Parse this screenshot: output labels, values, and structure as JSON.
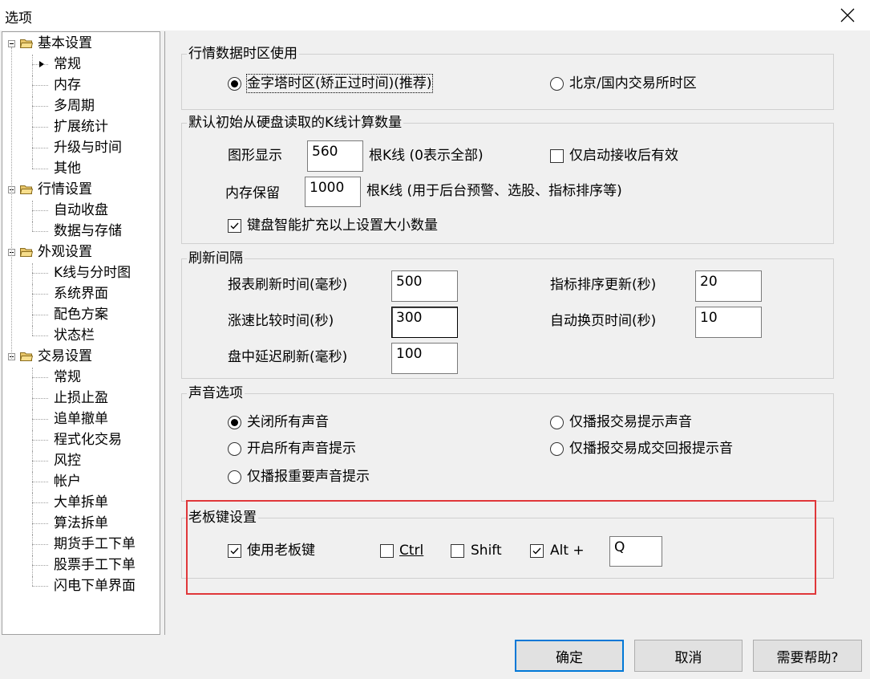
{
  "window": {
    "title": "选项"
  },
  "tree": {
    "nodes": [
      {
        "label": "基本设置",
        "level": 0
      },
      {
        "label": "常规",
        "level": 1,
        "selected": true
      },
      {
        "label": "内存",
        "level": 1
      },
      {
        "label": "多周期",
        "level": 1
      },
      {
        "label": "扩展统计",
        "level": 1
      },
      {
        "label": "升级与时间",
        "level": 1
      },
      {
        "label": "其他",
        "level": 1
      },
      {
        "label": "行情设置",
        "level": 0
      },
      {
        "label": "自动收盘",
        "level": 1
      },
      {
        "label": "数据与存储",
        "level": 1
      },
      {
        "label": "外观设置",
        "level": 0
      },
      {
        "label": "K线与分时图",
        "level": 1
      },
      {
        "label": "系统界面",
        "level": 1
      },
      {
        "label": "配色方案",
        "level": 1
      },
      {
        "label": "状态栏",
        "level": 1
      },
      {
        "label": "交易设置",
        "level": 0
      },
      {
        "label": "常规",
        "level": 1
      },
      {
        "label": "止损止盈",
        "level": 1
      },
      {
        "label": "追单撤单",
        "level": 1
      },
      {
        "label": "程式化交易",
        "level": 1
      },
      {
        "label": "风控",
        "level": 1
      },
      {
        "label": "帐户",
        "level": 1
      },
      {
        "label": "大单拆单",
        "level": 1
      },
      {
        "label": "算法拆单",
        "level": 1
      },
      {
        "label": "期货手工下单",
        "level": 1
      },
      {
        "label": "股票手工下单",
        "level": 1
      },
      {
        "label": "闪电下单界面",
        "level": 1
      }
    ]
  },
  "timezone": {
    "title": "行情数据时区使用",
    "opt_singapore": "金字塔时区(矫正过时间)(推荐)",
    "opt_beijing": "北京/国内交易所时区",
    "selected": "singapore"
  },
  "kline": {
    "title": "默认初始从硬盘读取的K线计算数量",
    "graphic_label": "图形显示",
    "graphic_value": "560",
    "graphic_unit": "根K线 (0表示全部)",
    "startup_only_label": "仅启动接收后有效",
    "startup_only_checked": false,
    "memory_label": "内存保留",
    "memory_value": "1000",
    "memory_unit": "根K线  (用于后台预警、选股、指标排序等)",
    "smart_expand_label": "键盘智能扩充以上设置大小数量",
    "smart_expand_checked": true
  },
  "refresh": {
    "title": "刷新间隔",
    "report_label": "报表刷新时间(毫秒)",
    "report_value": "500",
    "indicator_label": "指标排序更新(秒)",
    "indicator_value": "20",
    "speed_label": "涨速比较时间(秒)",
    "speed_value": "300",
    "pageflip_label": "自动换页时间(秒)",
    "pageflip_value": "10",
    "delay_label": "盘中延迟刷新(毫秒)",
    "delay_value": "100"
  },
  "sound": {
    "title": "声音选项",
    "opt_off": "关闭所有声音",
    "opt_trade_hint": "仅播报交易提示声音",
    "opt_all": "开启所有声音提示",
    "opt_trade_done": "仅播报交易成交回报提示音",
    "opt_important": "仅播报重要声音提示",
    "selected": "off"
  },
  "bosskey": {
    "title": "老板键设置",
    "use_label": "使用老板键",
    "use_checked": true,
    "ctrl_label": "Ctrl",
    "ctrl_checked": false,
    "shift_label": "Shift",
    "shift_checked": false,
    "alt_label": "Alt +",
    "alt_checked": true,
    "key_value": "Q"
  },
  "buttons": {
    "ok": "确定",
    "cancel": "取消",
    "help": "需要帮助?"
  },
  "colors": {
    "highlight_border": "#e0373a",
    "default_button_border": "#0078d7",
    "tree_bg": "#ffffff",
    "dialog_bg": "#f0f0f0"
  }
}
